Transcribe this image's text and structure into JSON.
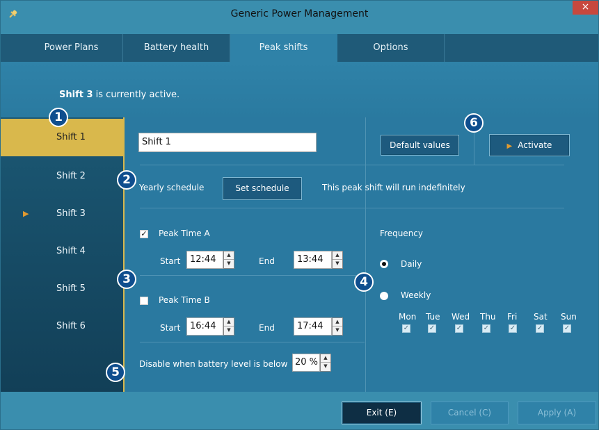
{
  "window": {
    "title": "Generic Power Management",
    "close_glyph": "×",
    "app_icon": "power-plug-icon"
  },
  "tabs": [
    {
      "label": "Power Plans",
      "active": false
    },
    {
      "label": "Battery health",
      "active": false
    },
    {
      "label": "Peak shifts",
      "active": true
    },
    {
      "label": "Options",
      "active": false
    }
  ],
  "status": {
    "shift_name": "Shift 3",
    "suffix": " is currently active."
  },
  "shifts": [
    {
      "label": "Shift 1",
      "selected": true,
      "active": false
    },
    {
      "label": "Shift 2",
      "selected": false,
      "active": false
    },
    {
      "label": "Shift 3",
      "selected": false,
      "active": true
    },
    {
      "label": "Shift 4",
      "selected": false,
      "active": false
    },
    {
      "label": "Shift 5",
      "selected": false,
      "active": false
    },
    {
      "label": "Shift 6",
      "selected": false,
      "active": false
    }
  ],
  "badges": [
    "1",
    "2",
    "3",
    "4",
    "5",
    "6"
  ],
  "editor": {
    "name_value": "Shift 1",
    "default_values_label": "Default values",
    "activate_label": "Activate",
    "yearly_schedule_label": "Yearly schedule",
    "set_schedule_label": "Set schedule",
    "schedule_note": "This peak shift will run indefinitely",
    "peak_a": {
      "label": "Peak Time A",
      "checked": true,
      "start_label": "Start",
      "start": "12:44",
      "end_label": "End",
      "end": "13:44"
    },
    "peak_b": {
      "label": "Peak Time B",
      "checked": false,
      "start_label": "Start",
      "start": "16:44",
      "end_label": "End",
      "end": "17:44"
    },
    "battery_label": "Disable when battery level is below",
    "battery_value": "20 %",
    "frequency": {
      "label": "Frequency",
      "daily_label": "Daily",
      "weekly_label": "Weekly",
      "selected": "Daily",
      "days": [
        "Mon",
        "Tue",
        "Wed",
        "Thu",
        "Fri",
        "Sat",
        "Sun"
      ]
    }
  },
  "footer": {
    "exit_label": "Exit (E)",
    "cancel_label": "Cancel (C)",
    "apply_label": "Apply (A)"
  },
  "colors": {
    "accent": "#3a8eae",
    "selected_shift": "#d9b84c",
    "badge": "#0f4e8e",
    "close": "#c7483e"
  }
}
